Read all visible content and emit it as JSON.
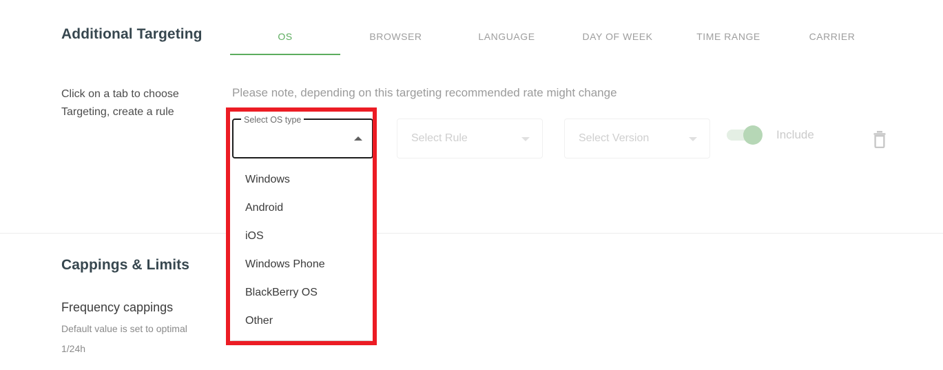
{
  "sections": {
    "targeting": {
      "title": "Additional Targeting",
      "helper_text": "Click on a tab to choose Targeting, create a rule",
      "note": "Please note, depending on this targeting recommended rate might change"
    },
    "cappings": {
      "title": "Cappings & Limits",
      "frequency_title": "Frequency cappings",
      "frequency_desc": "Default value is set to optimal",
      "frequency_value": "1/24h"
    }
  },
  "tabs": [
    {
      "label": "OS",
      "active": true
    },
    {
      "label": "BROWSER",
      "active": false
    },
    {
      "label": "LANGUAGE",
      "active": false
    },
    {
      "label": "DAY OF WEEK",
      "active": false
    },
    {
      "label": "TIME RANGE",
      "active": false
    },
    {
      "label": "CARRIER",
      "active": false
    }
  ],
  "rule_row": {
    "os_select": {
      "label": "Select OS type",
      "value": "",
      "open": true,
      "caret_icon": "caret-up-icon"
    },
    "rule_select": {
      "placeholder": "Select Rule",
      "value": "",
      "disabled": true,
      "caret_icon": "caret-down-icon"
    },
    "version_select": {
      "placeholder": "Select Version",
      "value": "",
      "disabled": true,
      "caret_icon": "caret-down-icon"
    },
    "include_toggle": {
      "label": "Include",
      "state": "on"
    },
    "delete_icon": "trash-icon"
  },
  "os_dropdown": {
    "options": [
      {
        "label": "Windows"
      },
      {
        "label": "Android"
      },
      {
        "label": "iOS"
      },
      {
        "label": "Windows Phone"
      },
      {
        "label": "BlackBerry OS"
      },
      {
        "label": "Other"
      }
    ]
  },
  "colors": {
    "accent_green": "#5cac5e",
    "toggle_knob": "#b6d7b6",
    "toggle_track": "#e4efe4",
    "annotation_red": "#ec1c24",
    "heading": "#37474f",
    "muted_text": "#9b9b9b",
    "disabled_text": "#cfcfcf"
  }
}
